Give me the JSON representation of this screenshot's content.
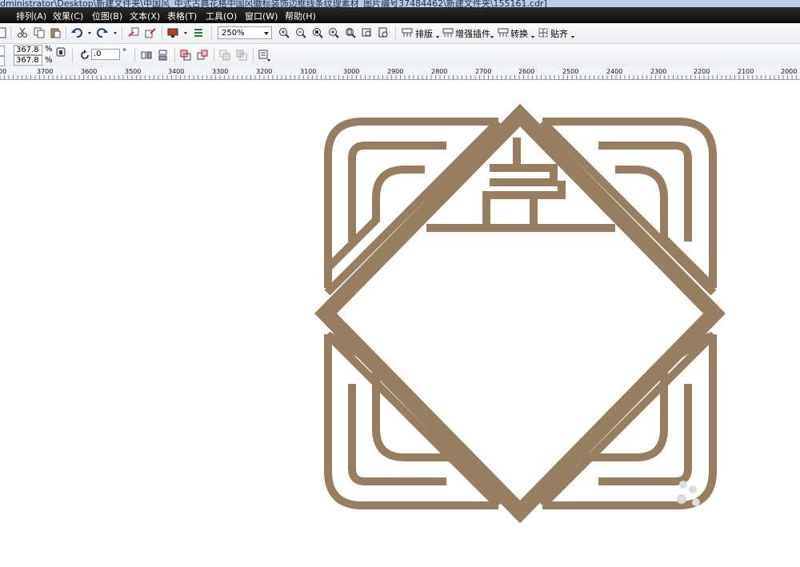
{
  "window": {
    "title": "dministrator\\Desktop\\新建文件夹\\中国风_中式古典花格中国风徽标装饰边框线条纹理素材_图片编号37484462\\新建文件夹\\155161.cdr]"
  },
  "menu": [
    "排列(A)",
    "效果(C)",
    "位图(B)",
    "文本(X)",
    "表格(T)",
    "工具(O)",
    "窗口(W)",
    "帮助(H)"
  ],
  "toolbar": {
    "zoom_value": "250%",
    "arrange_label": "排版",
    "plugin_label": "增强插件",
    "convert_label": "转换",
    "snap_label": "贴齐"
  },
  "property_bar": {
    "scale_x": "367.8",
    "scale_y": "367.8",
    "percent": "%",
    "rotation": ".0",
    "degree": "°"
  },
  "ruler": {
    "ticks": [
      "3700",
      "3600",
      "3500",
      "3400",
      "3300",
      "3200",
      "3100",
      "3000",
      "2900",
      "2800",
      "2700",
      "2600",
      "2500",
      "2400",
      "2300",
      "2200",
      "2100",
      "2000"
    ]
  },
  "artwork": {
    "color": "#977e61",
    "description_icon": "chinese-lattice-ornament"
  },
  "colors": {
    "menubar": "#111111",
    "titlebar": "#b9cde4",
    "toolbar": "#eef0f3"
  }
}
